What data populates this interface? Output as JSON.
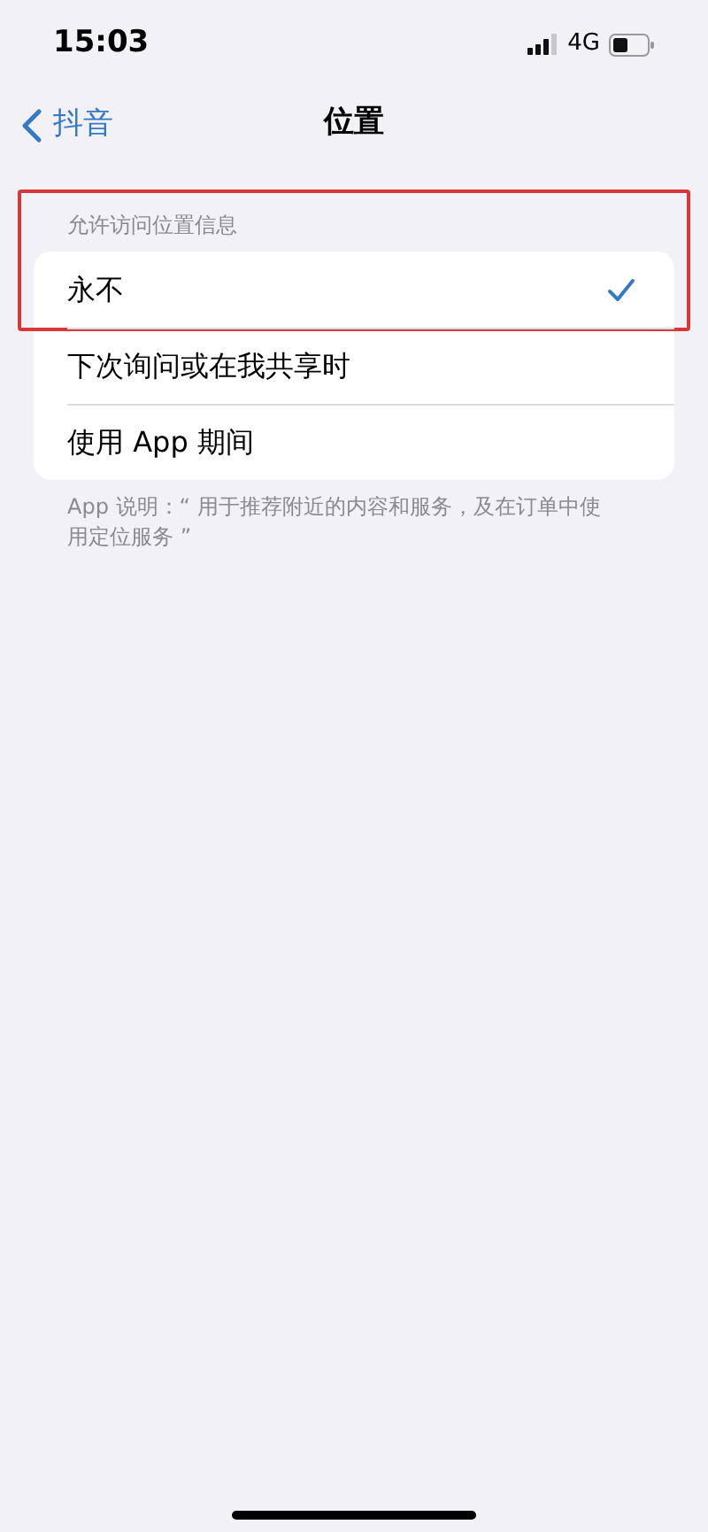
{
  "status_bar": {
    "time": "15:03",
    "network": "4G"
  },
  "nav": {
    "back_label": "抖音",
    "title": "位置"
  },
  "section": {
    "header": "允许访问位置信息",
    "highlighted": true,
    "options": [
      {
        "label": "永不",
        "selected": true
      },
      {
        "label": "下次询问或在我共享时",
        "selected": false
      },
      {
        "label": "使用 App 期间",
        "selected": false
      }
    ],
    "footer": "App 说明：“ 用于推荐附近的内容和服务，及在订单中使用定位服务 ”"
  }
}
